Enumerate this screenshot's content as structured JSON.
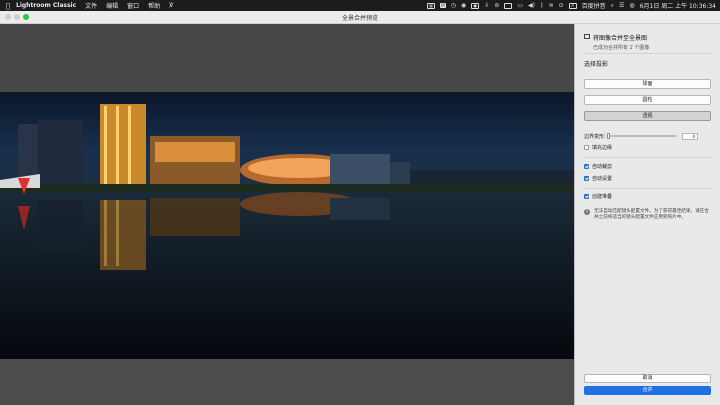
{
  "menubar": {
    "app_name": "Lightroom Classic",
    "menus": [
      "文件",
      "编辑",
      "窗口",
      "帮助"
    ],
    "input_method": "百度拼音",
    "datetime": "6月1日 周二 上午 10:36:34"
  },
  "window": {
    "title": "全景合并预览"
  },
  "sidebar": {
    "header_title": "将图像合并至全景图",
    "header_sub": "已成功合并所有 2 个图像",
    "projection_label": "选择投影",
    "projection_options": [
      "球面",
      "圆柱",
      "透视"
    ],
    "selected_projection": "透视",
    "boundary_warp_label": "边界变形:",
    "boundary_warp_value": "0",
    "fill_edges_label": "填充边缘",
    "fill_edges_checked": false,
    "auto_crop_label": "自动裁剪",
    "auto_crop_checked": true,
    "auto_settings_label": "自动设置",
    "auto_settings_checked": true,
    "create_stack_label": "创建堆叠",
    "create_stack_checked": true,
    "info_text": "无法自动匹配镜头配置文件。为了获得最佳结果，请在合并之前将适当的镜头配置文件应用到照片中。",
    "cancel_label": "取消",
    "merge_label": "合并"
  },
  "colors": {
    "accent": "#1f6fe5",
    "traffic_zoom": "#28c840"
  }
}
